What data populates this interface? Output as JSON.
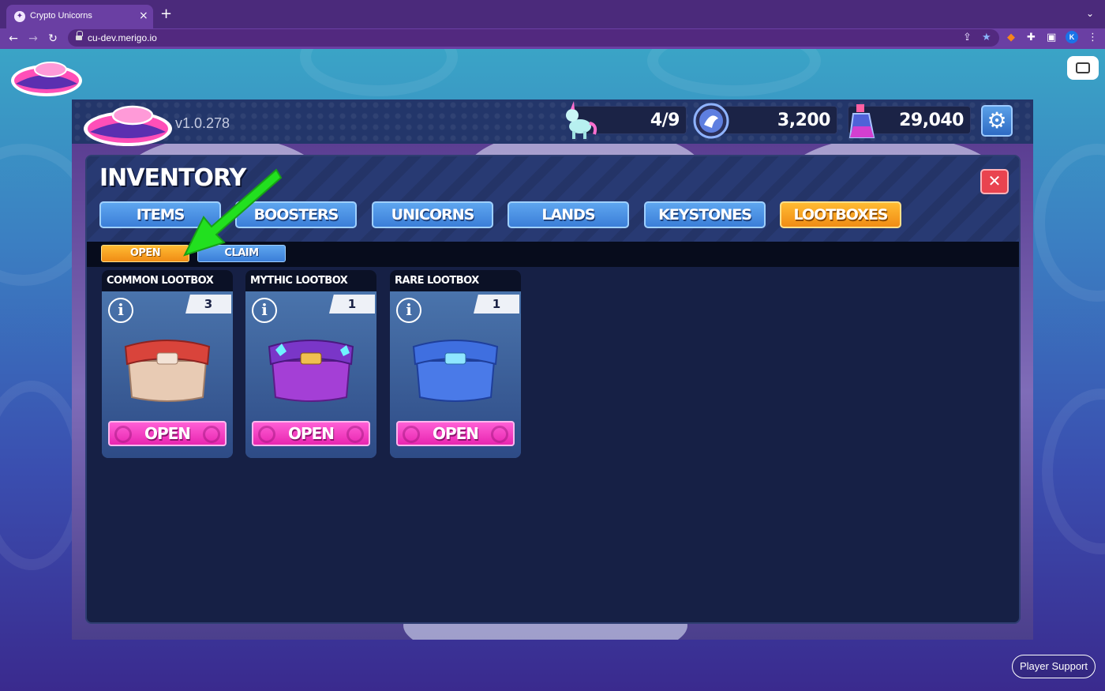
{
  "browser": {
    "tab_title": "Crypto Unicorns",
    "tab_close": "×",
    "new_tab": "+",
    "url": "cu-dev.merigo.io",
    "profile_initial": "K"
  },
  "game": {
    "version": "v1.0.278",
    "stats": {
      "unicorns": "4/9",
      "rbw": "3,200",
      "unim": "29,040"
    }
  },
  "inventory": {
    "title": "INVENTORY",
    "close_label": "✕",
    "tabs": [
      {
        "label": "ITEMS",
        "active": false
      },
      {
        "label": "BOOSTERS",
        "active": false
      },
      {
        "label": "UNICORNS",
        "active": false
      },
      {
        "label": "LANDS",
        "active": false
      },
      {
        "label": "KEYSTONES",
        "active": false
      },
      {
        "label": "LOOTBOXES",
        "active": true
      }
    ],
    "subtabs": [
      {
        "label": "OPEN",
        "active": true
      },
      {
        "label": "CLAIM",
        "active": false
      }
    ],
    "lootboxes": [
      {
        "name": "COMMON LOOTBOX",
        "count": "3",
        "button": "OPEN",
        "color": "#d9443b"
      },
      {
        "name": "MYTHIC LOOTBOX",
        "count": "1",
        "button": "OPEN",
        "color": "#9b3fd6"
      },
      {
        "name": "RARE LOOTBOX",
        "count": "1",
        "button": "OPEN",
        "color": "#3f6fe0"
      }
    ]
  },
  "support_label": "Player Support",
  "colors": {
    "accent_orange": "#f08c15",
    "tab_blue": "#3b7ed8",
    "open_pink": "#e826b0",
    "annotation_green": "#22e01f"
  }
}
